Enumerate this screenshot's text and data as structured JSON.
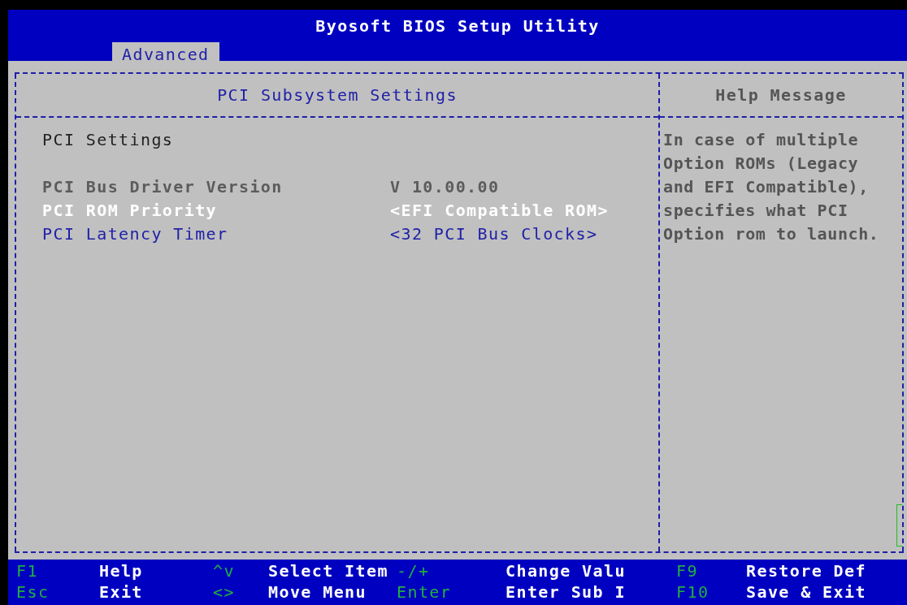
{
  "header": {
    "title": "Byosoft BIOS Setup Utility",
    "tabs": [
      {
        "label": "Advanced",
        "selected": true
      }
    ]
  },
  "panel": {
    "title": "PCI Subsystem Settings",
    "items": [
      {
        "kind": "heading",
        "label": "PCI Settings"
      },
      {
        "kind": "info",
        "label": "PCI Bus Driver Version",
        "value": "V 10.00.00"
      },
      {
        "kind": "option",
        "label": "PCI ROM Priority",
        "value": "<EFI Compatible ROM>",
        "selected": true
      },
      {
        "kind": "option",
        "label": "PCI Latency Timer",
        "value": "<32 PCI Bus Clocks>",
        "selected": false
      }
    ]
  },
  "help": {
    "title": "Help Message",
    "lines": [
      "In case of multiple",
      "Option ROMs (Legacy",
      "and EFI Compatible),",
      "specifies what PCI",
      "Option rom to launch."
    ]
  },
  "keys": [
    {
      "key": "F1",
      "action": "Help"
    },
    {
      "key": "^v",
      "action": "Select Item"
    },
    {
      "key": "-/+",
      "action": "Change Valu"
    },
    {
      "key": "F9",
      "action": "Restore Def"
    },
    {
      "key": "Esc",
      "action": "Exit"
    },
    {
      "key": "<>",
      "action": "Move Menu"
    },
    {
      "key": "Enter",
      "action": "Enter Sub I"
    },
    {
      "key": "F10",
      "action": "Save & Exit"
    }
  ]
}
